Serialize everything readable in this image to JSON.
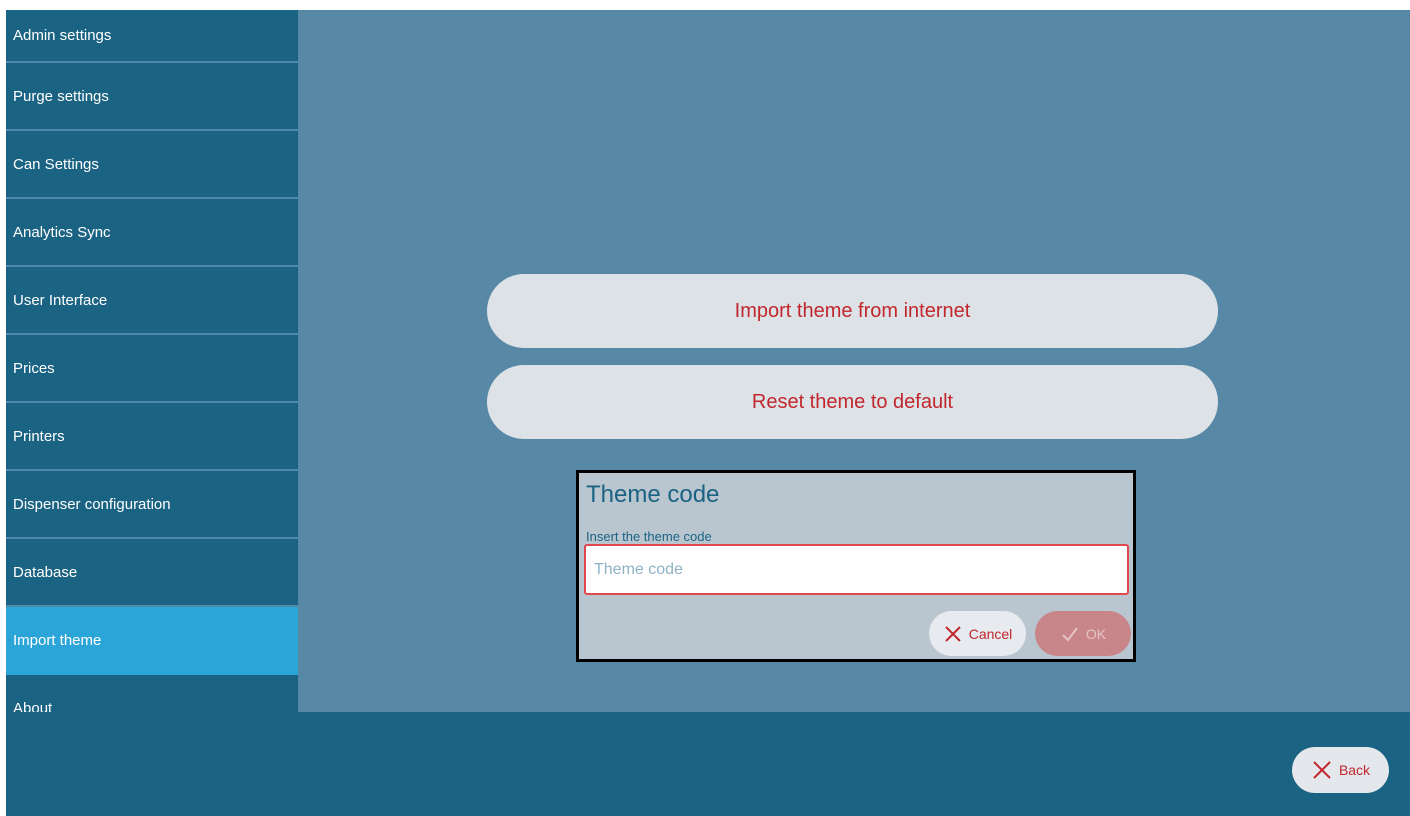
{
  "sidebar": {
    "items": [
      {
        "label": "Admin settings"
      },
      {
        "label": "Purge settings"
      },
      {
        "label": "Can Settings"
      },
      {
        "label": "Analytics Sync"
      },
      {
        "label": "User Interface"
      },
      {
        "label": "Prices"
      },
      {
        "label": "Printers"
      },
      {
        "label": "Dispenser configuration"
      },
      {
        "label": "Database"
      },
      {
        "label": "Import theme",
        "active": true
      },
      {
        "label": "About"
      }
    ]
  },
  "main": {
    "import_button": "Import theme from internet",
    "reset_button": "Reset theme to default"
  },
  "dialog": {
    "title": "Theme code",
    "label": "Insert the theme code",
    "input_placeholder": "Theme code",
    "input_value": "",
    "cancel_label": "Cancel",
    "ok_label": "OK",
    "cancel_icon": "close-icon",
    "ok_icon": "check-icon"
  },
  "footer": {
    "back_label": "Back",
    "back_icon": "close-icon"
  },
  "colors": {
    "sidebar_bg": "#1b6383",
    "active_item": "#2ba4d8",
    "main_bg": "#5788a6",
    "accent_text": "#c1272d",
    "dialog_bg": "#b9c6cf"
  }
}
